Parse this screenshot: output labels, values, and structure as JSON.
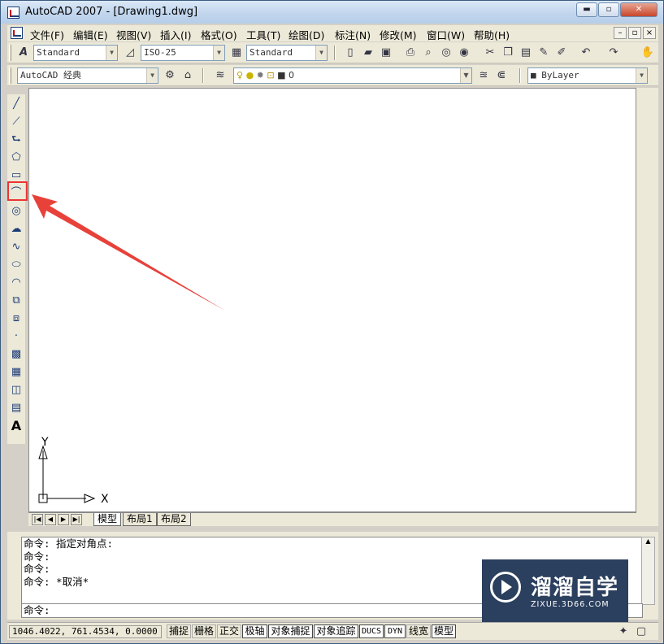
{
  "window": {
    "title": "AutoCAD 2007 - [Drawing1.dwg]",
    "minimize": "▬",
    "maximize": "▫",
    "close": "✕"
  },
  "menu": {
    "items": [
      "文件(F)",
      "编辑(E)",
      "视图(V)",
      "插入(I)",
      "格式(O)",
      "工具(T)",
      "绘图(D)",
      "标注(N)",
      "修改(M)",
      "窗口(W)",
      "帮助(H)"
    ],
    "mdi": [
      "–",
      "▫",
      "×"
    ]
  },
  "toolbar1": {
    "text_style": "Standard",
    "dim_style": "ISO-25",
    "table_style": "Standard"
  },
  "toolbar2": {
    "workspace": "AutoCAD 经典",
    "layer": "0",
    "color": "ByLayer"
  },
  "tabs": {
    "nav": [
      "|◀",
      "◀",
      "▶",
      "▶|"
    ],
    "items": [
      "模型",
      "布局1",
      "布局2"
    ]
  },
  "ucs": {
    "y_label": "Y",
    "x_label": "X"
  },
  "command": {
    "history": [
      "命令: 指定对角点:",
      "命令:",
      "命令:",
      "命令: *取消*"
    ],
    "prompt": "命令:"
  },
  "status": {
    "coords": "1046.4022, 761.4534, 0.0000",
    "toggles": [
      "捕捉",
      "栅格",
      "正交",
      "极轴",
      "对象捕捉",
      "对象追踪",
      "DUCS",
      "DYN",
      "线宽",
      "模型"
    ]
  },
  "watermark": {
    "title": "溜溜自学",
    "url": "ZIXUE.3D66.COM"
  },
  "colors": {
    "highlight": "#e33333",
    "arrow": "#e8413a",
    "canvas": "#ffffff"
  }
}
